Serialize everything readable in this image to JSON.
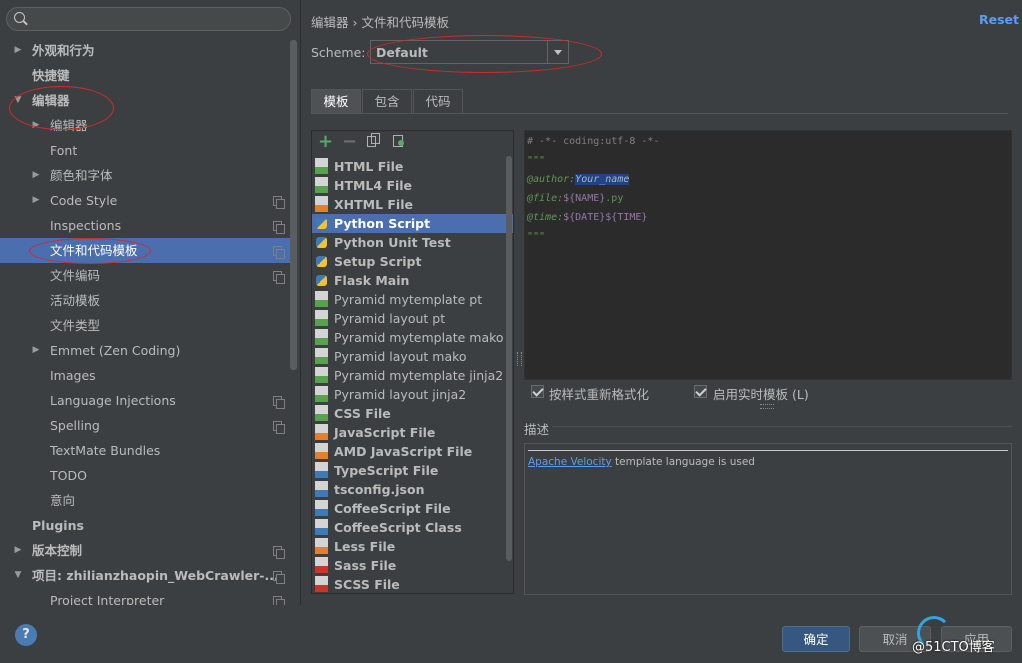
{
  "search": {
    "placeholder": ""
  },
  "tree": [
    {
      "label": "外观和行为",
      "bold": true,
      "arrow": "▶",
      "level": 0
    },
    {
      "label": "快捷键",
      "bold": true,
      "arrow": "",
      "level": 0
    },
    {
      "label": "编辑器",
      "bold": true,
      "arrow": "▼",
      "level": 0
    },
    {
      "label": "编辑器",
      "bold": false,
      "arrow": "▶",
      "level": 1
    },
    {
      "label": "Font",
      "bold": false,
      "arrow": "",
      "level": 1
    },
    {
      "label": "颜色和字体",
      "bold": false,
      "arrow": "▶",
      "level": 1
    },
    {
      "label": "Code Style",
      "bold": false,
      "arrow": "▶",
      "level": 1,
      "copy": true
    },
    {
      "label": "Inspections",
      "bold": false,
      "arrow": "",
      "level": 1,
      "copy": true
    },
    {
      "label": "文件和代码模板",
      "bold": false,
      "arrow": "",
      "level": 1,
      "copy": true,
      "selected": true
    },
    {
      "label": "文件编码",
      "bold": false,
      "arrow": "",
      "level": 1,
      "copy": true
    },
    {
      "label": "活动模板",
      "bold": false,
      "arrow": "",
      "level": 1
    },
    {
      "label": "文件类型",
      "bold": false,
      "arrow": "",
      "level": 1
    },
    {
      "label": "Emmet (Zen Coding)",
      "bold": false,
      "arrow": "▶",
      "level": 1
    },
    {
      "label": "Images",
      "bold": false,
      "arrow": "",
      "level": 1
    },
    {
      "label": "Language Injections",
      "bold": false,
      "arrow": "",
      "level": 1,
      "copy": true
    },
    {
      "label": "Spelling",
      "bold": false,
      "arrow": "",
      "level": 1,
      "copy": true
    },
    {
      "label": "TextMate Bundles",
      "bold": false,
      "arrow": "",
      "level": 1
    },
    {
      "label": "TODO",
      "bold": false,
      "arrow": "",
      "level": 1
    },
    {
      "label": "意向",
      "bold": false,
      "arrow": "",
      "level": 1
    },
    {
      "label": "Plugins",
      "bold": true,
      "arrow": "",
      "level": 0
    },
    {
      "label": "版本控制",
      "bold": true,
      "arrow": "▶",
      "level": 0,
      "copy": true
    },
    {
      "label": "项目: zhilianzhaopin_WebCrawler-...",
      "bold": true,
      "arrow": "▼",
      "level": 0,
      "copy": true
    },
    {
      "label": "Project Interpreter",
      "bold": false,
      "arrow": "",
      "level": 1,
      "copy": true
    }
  ],
  "header": {
    "breadcrumb": "编辑器 › 文件和代码模板",
    "reset": "Reset",
    "scheme_label": "Scheme:",
    "scheme_value": "Default"
  },
  "tabs": [
    {
      "label": "模板",
      "active": true
    },
    {
      "label": "包含",
      "active": false
    },
    {
      "label": "代码",
      "active": false
    }
  ],
  "toolbar": {
    "add": "+",
    "remove": "−"
  },
  "files": [
    {
      "name": "HTML File",
      "bold": true,
      "icon": "html",
      "color": "#58a14e"
    },
    {
      "name": "HTML4 File",
      "bold": true,
      "icon": "html",
      "color": "#58a14e"
    },
    {
      "name": "XHTML File",
      "bold": true,
      "icon": "html",
      "color": "#e2812b"
    },
    {
      "name": "Python Script",
      "bold": true,
      "icon": "python",
      "color": "#3e7bb6",
      "selected": true
    },
    {
      "name": "Python Unit Test",
      "bold": true,
      "icon": "python",
      "color": "#3e7bb6"
    },
    {
      "name": "Setup Script",
      "bold": true,
      "icon": "python",
      "color": "#3e7bb6"
    },
    {
      "name": "Flask Main",
      "bold": true,
      "icon": "python",
      "color": "#3e7bb6"
    },
    {
      "name": "Pyramid mytemplate pt",
      "bold": false,
      "icon": "template",
      "color": "#58a14e"
    },
    {
      "name": "Pyramid layout pt",
      "bold": false,
      "icon": "template",
      "color": "#58a14e"
    },
    {
      "name": "Pyramid mytemplate mako",
      "bold": false,
      "icon": "template",
      "color": "#58a14e"
    },
    {
      "name": "Pyramid layout mako",
      "bold": false,
      "icon": "template",
      "color": "#58a14e"
    },
    {
      "name": "Pyramid mytemplate jinja2",
      "bold": false,
      "icon": "template",
      "color": "#58a14e"
    },
    {
      "name": "Pyramid layout jinja2",
      "bold": false,
      "icon": "template",
      "color": "#58a14e"
    },
    {
      "name": "CSS File",
      "bold": true,
      "icon": "css",
      "color": "#58a14e"
    },
    {
      "name": "JavaScript File",
      "bold": true,
      "icon": "js",
      "color": "#e2812b"
    },
    {
      "name": "AMD JavaScript File",
      "bold": true,
      "icon": "js",
      "color": "#e2812b"
    },
    {
      "name": "TypeScript File",
      "bold": true,
      "icon": "ts",
      "color": "#3e7bb6"
    },
    {
      "name": "tsconfig.json",
      "bold": true,
      "icon": "json",
      "color": "#3e7bb6"
    },
    {
      "name": "CoffeeScript File",
      "bold": true,
      "icon": "coffee",
      "color": "#3e7bb6"
    },
    {
      "name": "CoffeeScript Class",
      "bold": true,
      "icon": "coffee",
      "color": "#3e7bb6"
    },
    {
      "name": "Less File",
      "bold": true,
      "icon": "less",
      "color": "#e2812b"
    },
    {
      "name": "Sass File",
      "bold": true,
      "icon": "sass",
      "color": "#c0392b"
    },
    {
      "name": "SCSS File",
      "bold": true,
      "icon": "scss",
      "color": "#c0392b"
    }
  ],
  "editor": {
    "line1": "# -*- coding:utf-8 -*-",
    "line2": "\"\"\"",
    "author_tag": "@author:",
    "author_val": "Your_name",
    "file_tag": "@file:",
    "file_val": "${NAME}",
    "file_ext": ".py",
    "time_tag": "@time:",
    "time_date": "${DATE}",
    "time_time": "${TIME}",
    "line6": "\"\"\""
  },
  "options": {
    "reformat": "按样式重新格式化",
    "live_templates": "启用实时模板 (L)"
  },
  "description": {
    "title": "描述",
    "link": "Apache Velocity",
    "text": " template language is used"
  },
  "footer": {
    "help": "?",
    "ok": "确定",
    "cancel": "取消",
    "apply": "应用"
  },
  "watermark": "@51CTO博客",
  "colors": {
    "selection": "#4b6eaf",
    "link": "#589df6",
    "annotation": "#d42a2a"
  }
}
